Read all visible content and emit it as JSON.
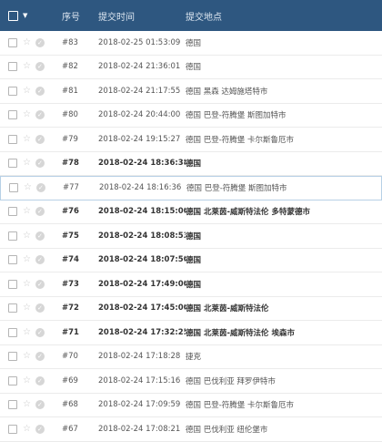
{
  "header": {
    "col_num": "序号",
    "col_time": "提交时间",
    "col_location": "提交地点"
  },
  "rows": [
    {
      "num": "#83",
      "time": "2018-02-25 01:53:09",
      "location": "德国",
      "unread": false
    },
    {
      "num": "#82",
      "time": "2018-02-24 21:36:01",
      "location": "德国",
      "unread": false
    },
    {
      "num": "#81",
      "time": "2018-02-24 21:17:55",
      "location": "德国 黑森 达姆施塔特市",
      "unread": false
    },
    {
      "num": "#80",
      "time": "2018-02-24 20:44:00",
      "location": "德国 巴登-符腾堡 斯图加特市",
      "unread": false
    },
    {
      "num": "#79",
      "time": "2018-02-24 19:15:27",
      "location": "德国 巴登-符腾堡 卡尔斯鲁厄市",
      "unread": false
    },
    {
      "num": "#78",
      "time": "2018-02-24 18:36:38",
      "location": "德国",
      "unread": true
    },
    {
      "num": "#77",
      "time": "2018-02-24 18:16:36",
      "location": "德国 巴登-符腾堡 斯图加特市",
      "unread": false
    },
    {
      "num": "#76",
      "time": "2018-02-24 18:15:00",
      "location": "德国 北莱茵-威斯特法伦 多特蒙德市",
      "unread": true
    },
    {
      "num": "#75",
      "time": "2018-02-24 18:08:53",
      "location": "德国",
      "unread": true
    },
    {
      "num": "#74",
      "time": "2018-02-24 18:07:50",
      "location": "德国",
      "unread": true
    },
    {
      "num": "#73",
      "time": "2018-02-24 17:49:00",
      "location": "德国",
      "unread": true
    },
    {
      "num": "#72",
      "time": "2018-02-24 17:45:00",
      "location": "德国 北莱茵-威斯特法伦",
      "unread": true
    },
    {
      "num": "#71",
      "time": "2018-02-24 17:32:25",
      "location": "德国 北莱茵-威斯特法伦 埃森市",
      "unread": true
    },
    {
      "num": "#70",
      "time": "2018-02-24 17:18:28",
      "location": "捷克",
      "unread": false
    },
    {
      "num": "#69",
      "time": "2018-02-24 17:15:16",
      "location": "德国 巴伐利亚 拜罗伊特市",
      "unread": false
    },
    {
      "num": "#68",
      "time": "2018-02-24 17:09:59",
      "location": "德国 巴登-符腾堡 卡尔斯鲁厄市",
      "unread": false
    },
    {
      "num": "#67",
      "time": "2018-02-24 17:08:21",
      "location": "德国 巴伐利亚 纽伦堡市",
      "unread": false
    }
  ]
}
